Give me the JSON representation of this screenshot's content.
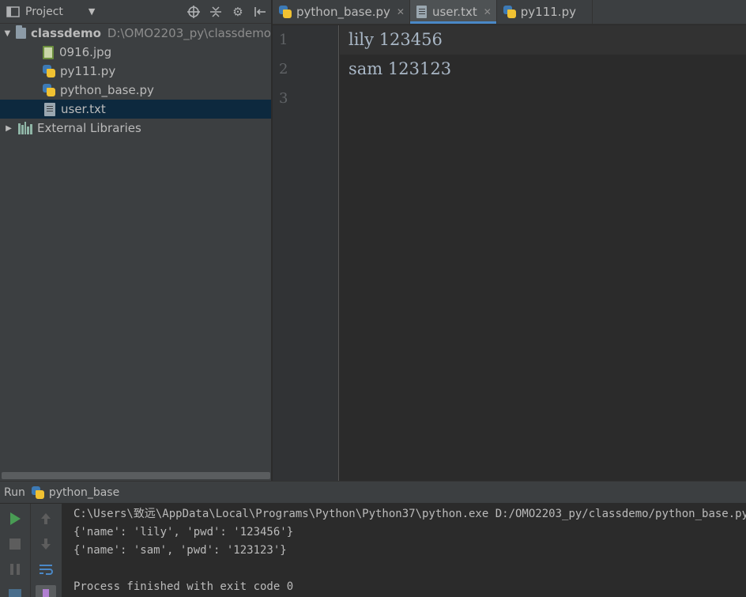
{
  "project_panel": {
    "title": "Project",
    "tree": {
      "root": {
        "name": "classdemo",
        "path": "D:\\OMO2203_py\\classdemo"
      },
      "files": [
        {
          "name": "0916.jpg",
          "icon": "image-file-icon"
        },
        {
          "name": "py111.py",
          "icon": "python-file-icon"
        },
        {
          "name": "python_base.py",
          "icon": "python-file-icon"
        },
        {
          "name": "user.txt",
          "icon": "text-file-icon"
        }
      ],
      "external_libraries": "External Libraries"
    }
  },
  "editor": {
    "tabs": [
      {
        "label": "python_base.py",
        "icon": "python-file-icon",
        "active": false
      },
      {
        "label": "user.txt",
        "icon": "text-file-icon",
        "active": true
      },
      {
        "label": "py111.py",
        "icon": "python-file-icon",
        "active": false
      }
    ],
    "line_numbers": [
      "1",
      "2",
      "3"
    ],
    "lines": [
      "lily 123456",
      "sam 123123",
      ""
    ]
  },
  "run_panel": {
    "label": "Run",
    "config": "python_base",
    "console": [
      "C:\\Users\\致远\\AppData\\Local\\Programs\\Python\\Python37\\python.exe D:/OMO2203_py/classdemo/python_base.py",
      "{'name': 'lily', 'pwd': '123456'}",
      "{'name': 'sam', 'pwd': '123123'}",
      "",
      "Process finished with exit code 0"
    ]
  },
  "colors": {
    "accent": "#4a88c7",
    "selection": "#0d293e",
    "run_green": "#499c54"
  }
}
